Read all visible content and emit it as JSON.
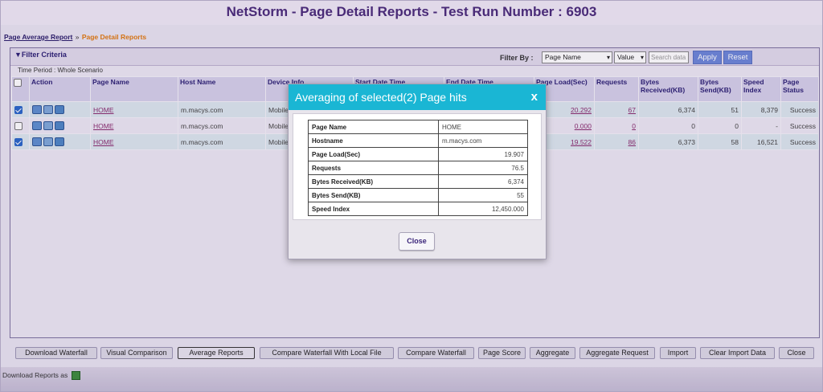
{
  "title": "NetStorm - Page Detail Reports - Test Run Number : 6903",
  "breadcrumb": {
    "link": "Page Average Report",
    "separator": "»",
    "current": "Page Detail Reports"
  },
  "filter": {
    "title": "▼Filter Criteria",
    "filter_by_label": "Filter By :",
    "select_name": "Page Name",
    "select_value": "Value",
    "search_placeholder": "Search data",
    "apply": "Apply",
    "reset": "Reset",
    "time_period": "Time Period : Whole Scenario"
  },
  "table": {
    "headers": {
      "action": "Action",
      "page_name": "Page Name",
      "host_name": "Host Name",
      "device_info": "Device Info",
      "start": "Start Date Time",
      "end": "End Date Time",
      "page_load": "Page Load(Sec)",
      "requests": "Requests",
      "bytes_received": "Bytes Received(KB)",
      "bytes_send": "Bytes Send(KB)",
      "speed_index": "Speed Index",
      "page_status": "Page Status"
    },
    "rows": [
      {
        "checked": true,
        "page_name": "HOME",
        "host": "m.macys.com",
        "device": "Mobile",
        "page_load": "20.292",
        "requests": "67",
        "bytes_received": "6,374",
        "bytes_send": "51",
        "speed_index": "8,379",
        "status": "Success"
      },
      {
        "checked": false,
        "page_name": "HOME",
        "host": "m.macys.com",
        "device": "Mobile",
        "page_load": "0.000",
        "requests": "0",
        "bytes_received": "0",
        "bytes_send": "0",
        "speed_index": "-",
        "status": "Success"
      },
      {
        "checked": true,
        "page_name": "HOME",
        "host": "m.macys.com",
        "device": "Mobile",
        "page_load": "19.522",
        "requests": "86",
        "bytes_received": "6,373",
        "bytes_send": "58",
        "speed_index": "16,521",
        "status": "Success"
      }
    ]
  },
  "bottom_buttons": {
    "download_waterfall": "Download Waterfall",
    "visual_comparison": "Visual Comparison",
    "average_reports": "Average Reports",
    "compare_local": "Compare Waterfall With Local File",
    "compare_waterfall": "Compare Waterfall",
    "page_score": "Page Score",
    "aggregate": "Aggregate",
    "aggregate_request": "Aggregate Request",
    "import": "Import",
    "clear_import": "Clear Import Data",
    "close": "Close"
  },
  "download_reports_as": "Download Reports as",
  "modal": {
    "title": "Averaging of selected(2) Page hits",
    "close_x": "x",
    "rows": [
      {
        "k": "Page Name",
        "v": "HOME"
      },
      {
        "k": "Hostname",
        "v": "m.macys.com"
      },
      {
        "k": "Page Load(Sec)",
        "v": "19.907"
      },
      {
        "k": "Requests",
        "v": "76.5"
      },
      {
        "k": "Bytes Received(KB)",
        "v": "6,374"
      },
      {
        "k": "Bytes Send(KB)",
        "v": "55"
      },
      {
        "k": "Speed Index",
        "v": "12,450.000"
      }
    ],
    "close_button": "Close"
  }
}
